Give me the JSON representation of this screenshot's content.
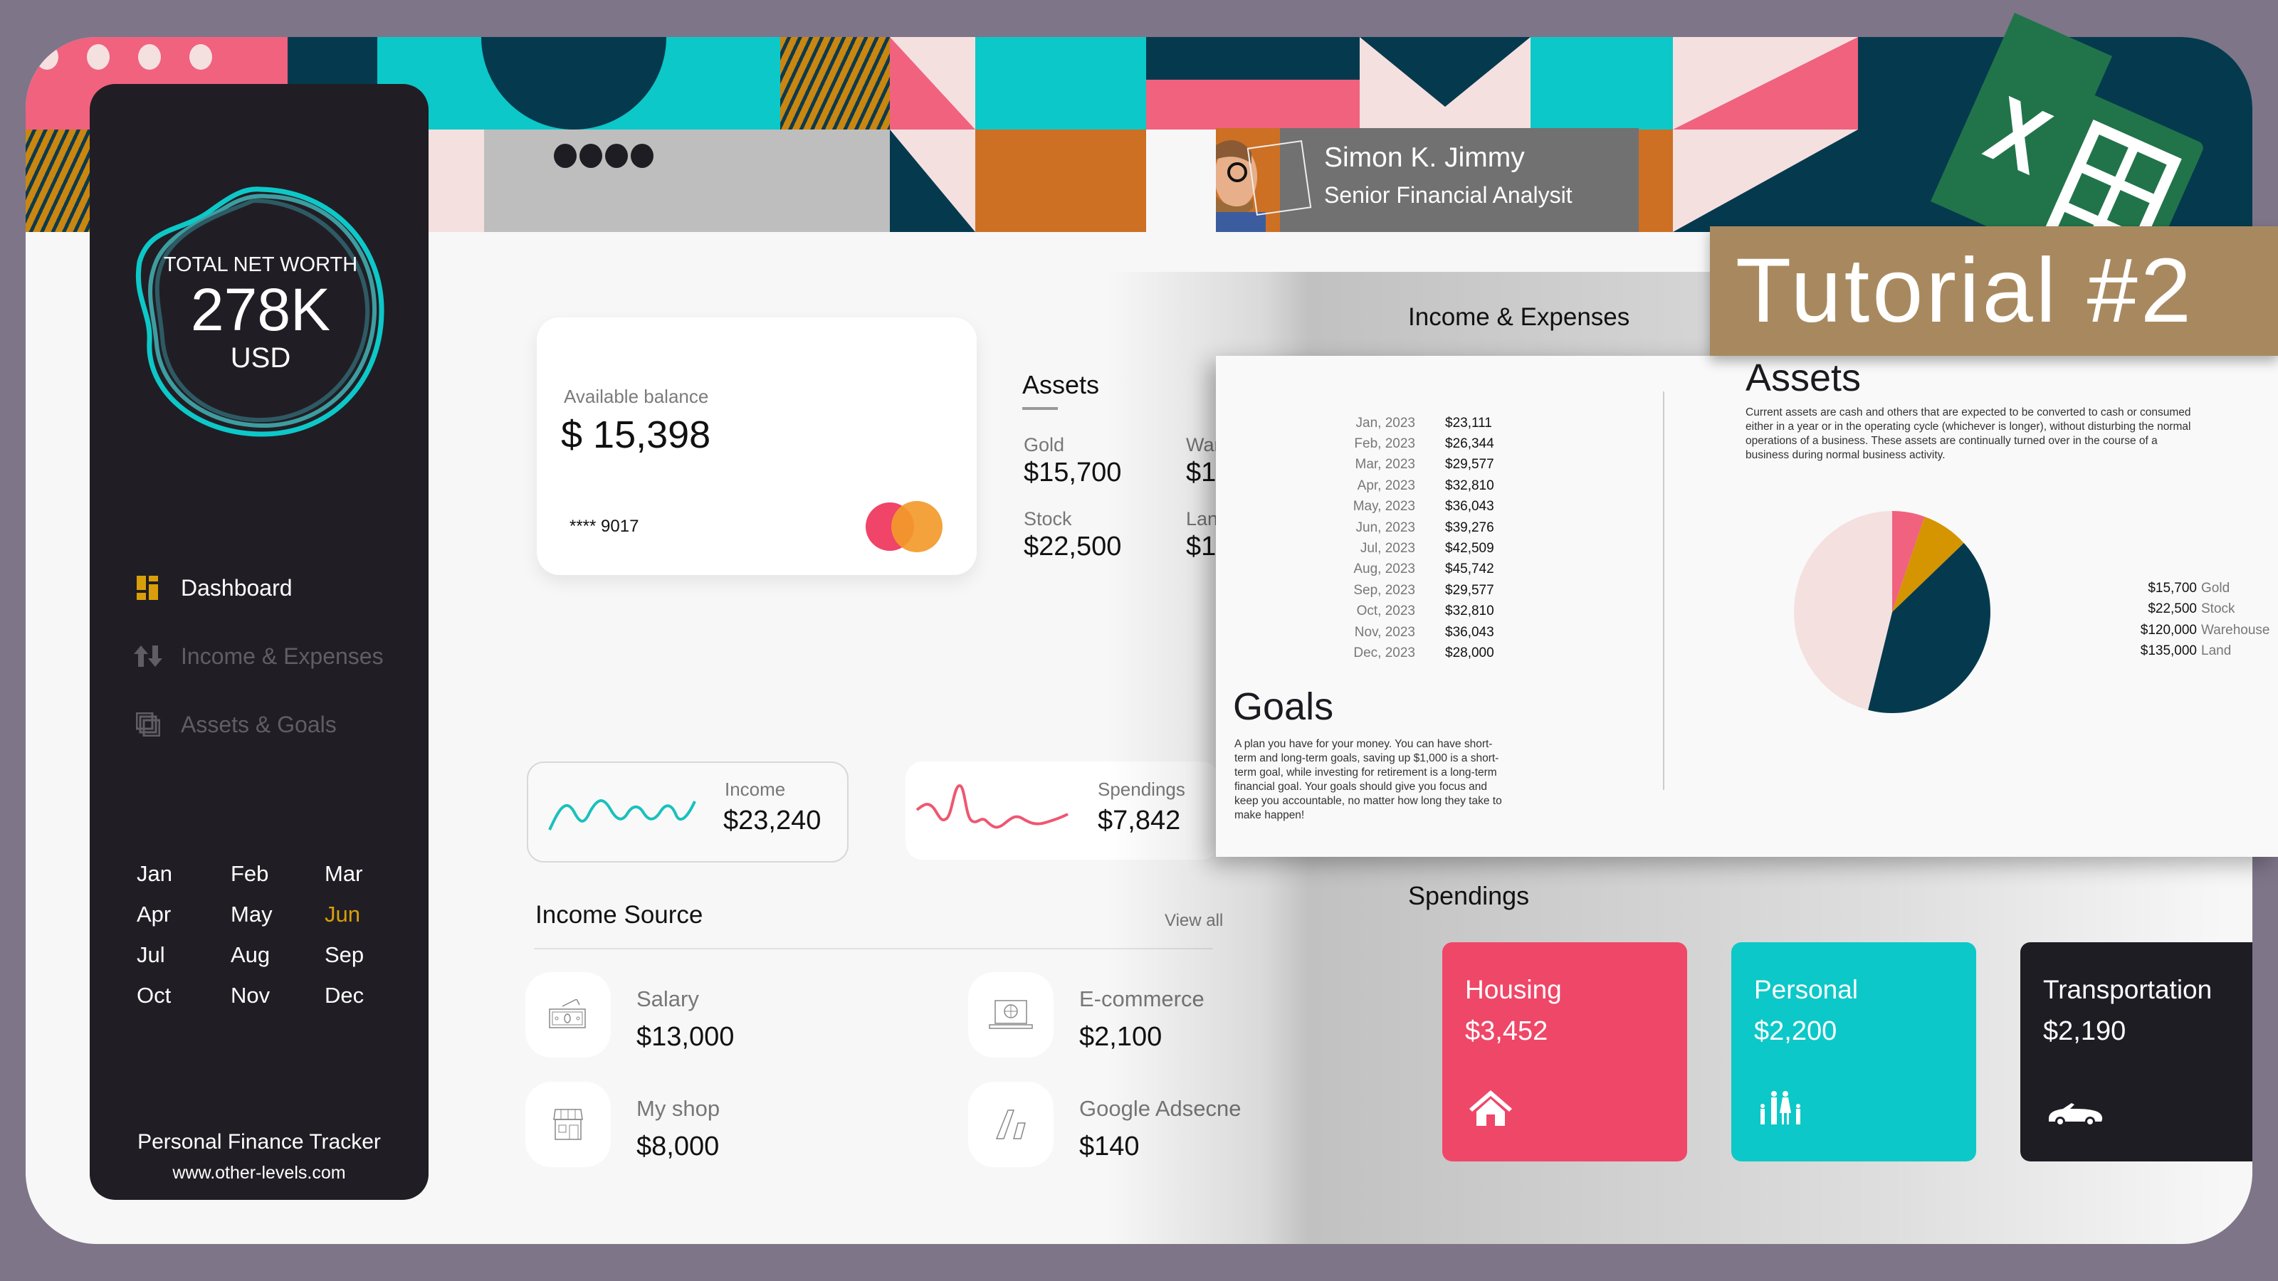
{
  "profile": {
    "name": "Simon K. Jimmy",
    "role": "Senior Financial Analysit"
  },
  "badge": {
    "tutorial": "Tutorial #2",
    "app_icon": "excel-icon"
  },
  "sidebar": {
    "net_worth_label": "TOTAL NET WORTH",
    "net_worth_value": "278K",
    "net_worth_unit": "USD",
    "nav": [
      {
        "label": "Dashboard",
        "icon": "dashboard-icon",
        "active": true
      },
      {
        "label": "Income & Expenses",
        "icon": "arrows-up-down-icon",
        "active": false
      },
      {
        "label": "Assets & Goals",
        "icon": "copy-stack-icon",
        "active": false
      }
    ],
    "months": [
      "Jan",
      "Feb",
      "Mar",
      "Apr",
      "May",
      "Jun",
      "Jul",
      "Aug",
      "Sep",
      "Oct",
      "Nov",
      "Dec"
    ],
    "active_month": "Jun",
    "footer_title": "Personal Finance Tracker",
    "footer_url": "www.other-levels.com"
  },
  "balance_card": {
    "label": "Available balance",
    "value": "$ 15,398",
    "card_number": "**** 9017",
    "brand_icon": "mastercard-icon"
  },
  "assets_mini": {
    "title": "Assets",
    "items": [
      {
        "label": "Gold",
        "value": "$15,700"
      },
      {
        "label": "Stock",
        "value": "$22,500"
      },
      {
        "label": "War",
        "value": "$1"
      },
      {
        "label": "Lan",
        "value": "$1"
      }
    ]
  },
  "summary": {
    "income": {
      "label": "Income",
      "value": "$23,240"
    },
    "spendings": {
      "label": "Spendings",
      "value": "$7,842"
    }
  },
  "income_source": {
    "title": "Income Source",
    "view_all": "View all",
    "items": [
      {
        "label": "Salary",
        "value": "$13,000",
        "icon": "cash-icon"
      },
      {
        "label": "E-commerce",
        "value": "$2,100",
        "icon": "laptop-globe-icon"
      },
      {
        "label": "My shop",
        "value": "$8,000",
        "icon": "storefront-icon"
      },
      {
        "label": "Google Adsecne",
        "value": "$140",
        "icon": "adsense-icon"
      }
    ]
  },
  "income_expenses": {
    "title": "Income & Expenses",
    "rows": [
      {
        "month": "Jan, 2023",
        "amount": "$23,111"
      },
      {
        "month": "Feb, 2023",
        "amount": "$26,344"
      },
      {
        "month": "Mar, 2023",
        "amount": "$29,577"
      },
      {
        "month": "Apr, 2023",
        "amount": "$32,810"
      },
      {
        "month": "May, 2023",
        "amount": "$36,043"
      },
      {
        "month": "Jun, 2023",
        "amount": "$39,276"
      },
      {
        "month": "Jul, 2023",
        "amount": "$42,509"
      },
      {
        "month": "Aug, 2023",
        "amount": "$45,742"
      },
      {
        "month": "Sep, 2023",
        "amount": "$29,577"
      },
      {
        "month": "Oct, 2023",
        "amount": "$32,810"
      },
      {
        "month": "Nov, 2023",
        "amount": "$36,043"
      },
      {
        "month": "Dec, 2023",
        "amount": "$28,000"
      }
    ]
  },
  "goals": {
    "title": "Goals",
    "text": "A plan you have for your money. You can have short-term and long-term goals, saving up $1,000 is a short-term goal, while investing for retirement is a long-term financial goal. Your goals should give you focus and keep you accountable, no matter how long they take to make happen!"
  },
  "assets_panel": {
    "title": "Assets",
    "text": "Current assets are cash and others that are expected to be converted to cash or consumed either in a year or in the operating cycle (whichever is longer), without disturbing the normal operations of a business. These assets are continually turned over in the course of a business during normal business activity."
  },
  "chart_data": {
    "type": "pie",
    "title": "Assets",
    "legend_position": "right",
    "slices": [
      {
        "label": "Gold",
        "value": 15700,
        "display": "$15,700",
        "color": "#f0627e"
      },
      {
        "label": "Stock",
        "value": 22500,
        "display": "$22,500",
        "color": "#d49500"
      },
      {
        "label": "Warehouse",
        "value": 120000,
        "display": "$120,000",
        "color": "#053a4e"
      },
      {
        "label": "Land",
        "value": 135000,
        "display": "$135,000",
        "color": "#f5e0e0"
      }
    ]
  },
  "spendings": {
    "title": "Spendings",
    "cards": [
      {
        "label": "Housing",
        "value": "$3,452",
        "icon": "house-icon",
        "color": "#ef4768"
      },
      {
        "label": "Personal",
        "value": "$2,200",
        "icon": "family-icon",
        "color": "#0dc8c8"
      },
      {
        "label": "Transportation",
        "value": "$2,190",
        "icon": "car-icon",
        "color": "#1f1d24"
      }
    ]
  },
  "colors": {
    "accent_gold": "#d99f0a",
    "teal": "#0dc8c8",
    "pink": "#f0627e",
    "navy": "#053a4e",
    "sidebar": "#201e24"
  }
}
